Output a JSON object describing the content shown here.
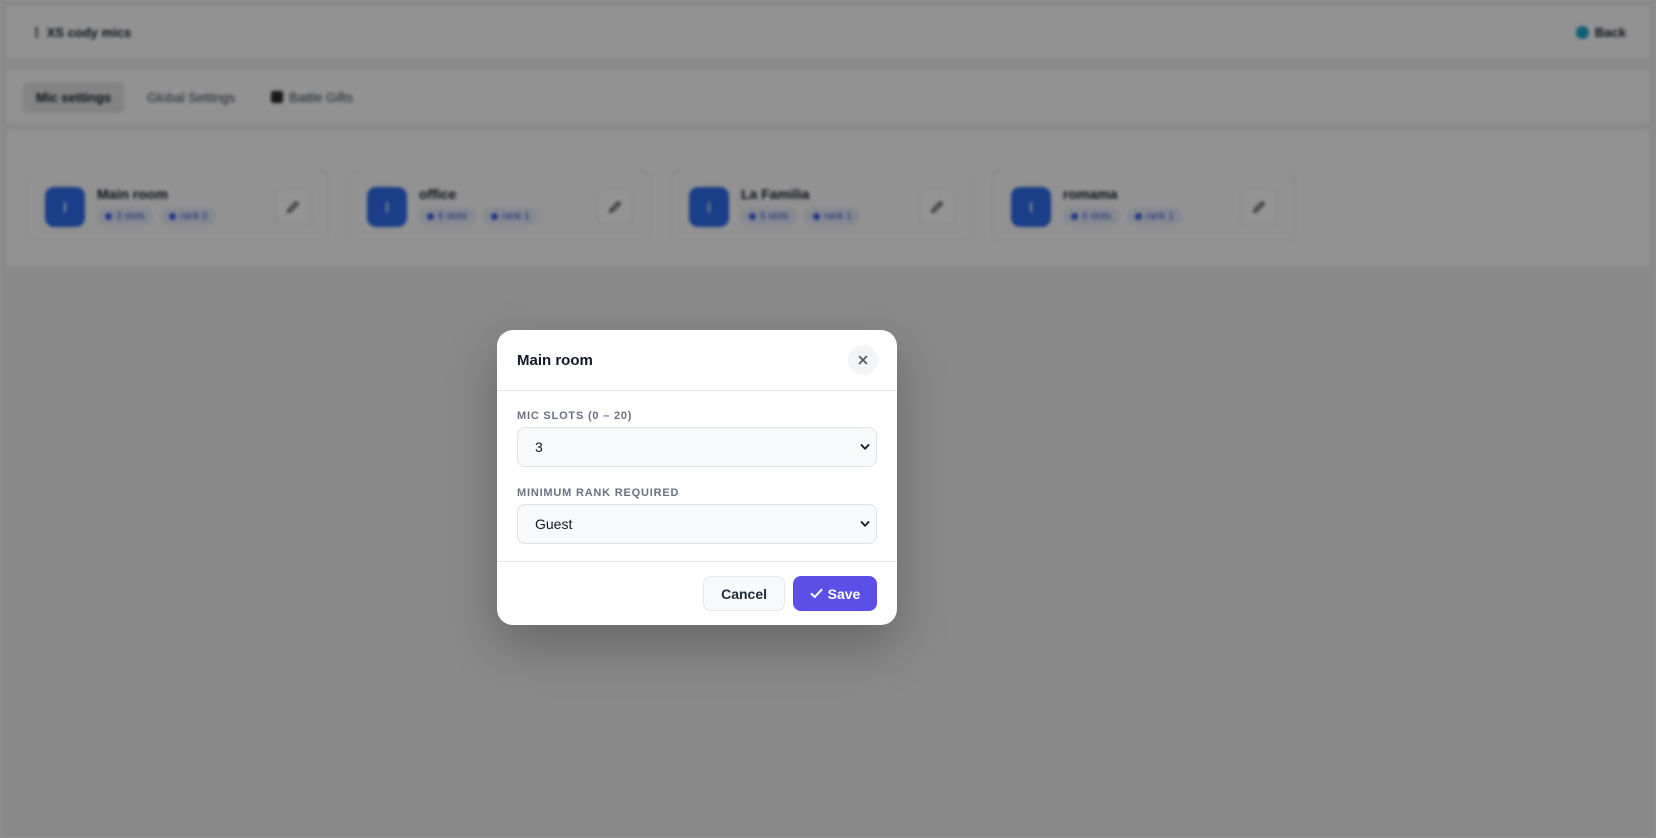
{
  "header": {
    "title": "⋮ XS cody mics",
    "back_label": "Back"
  },
  "tabs": [
    {
      "label": "Mic settings"
    },
    {
      "label": "Global Settings"
    },
    {
      "label": "Battle Gifts"
    }
  ],
  "rooms": [
    {
      "name": "Main room",
      "slots": "3 slots",
      "rank": "rank 0"
    },
    {
      "name": "office",
      "slots": "6 slots",
      "rank": "rank 1"
    },
    {
      "name": "La Familia",
      "slots": "6 slots",
      "rank": "rank 1"
    },
    {
      "name": "romama",
      "slots": "6 slots",
      "rank": "rank 1"
    }
  ],
  "modal": {
    "title": "Main room",
    "close_symbol": "×",
    "mic_slots_label": "MIC SLOTS (0 – 20)",
    "mic_slots_value": "3",
    "rank_label": "MINIMUM RANK REQUIRED",
    "rank_value": "Guest",
    "cancel_label": "Cancel",
    "save_label": "Save"
  },
  "colors": {
    "accent": "#5b4fe8",
    "room_icon": "#2f6bea",
    "back_dot": "#19a6c4"
  }
}
